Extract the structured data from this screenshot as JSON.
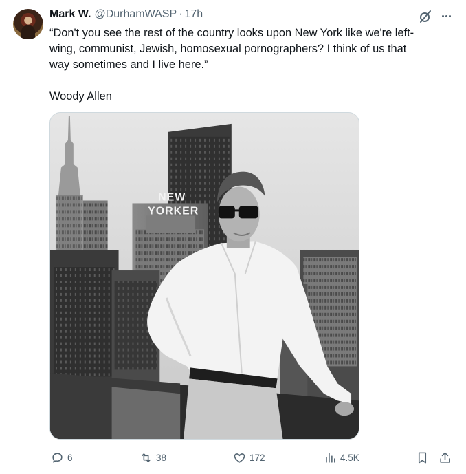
{
  "tweet": {
    "author_name": "Mark W.",
    "handle": "@DurhamWASP",
    "separator": "·",
    "time": "17h",
    "text_lines": [
      "“Don't you see the rest of the country looks upon New York like we're left-",
      "wing, communist, Jewish, homosexual pornographers? I think of us that",
      "way sometimes and I live here.”"
    ],
    "attribution": "Woody Allen",
    "media": {
      "sign_line1": "NEW",
      "sign_line2": "YORKER"
    }
  },
  "actions": {
    "reply_count": "6",
    "retweet_count": "38",
    "like_count": "172",
    "views_count": "4.5K"
  },
  "icons": {
    "more": "more-dots-icon",
    "grok": "grok-icon",
    "reply": "reply-icon",
    "retweet": "retweet-icon",
    "like": "heart-icon",
    "views": "views-icon",
    "bookmark": "bookmark-icon",
    "share": "share-icon"
  },
  "colors": {
    "text_primary": "#0f1419",
    "text_secondary": "#536471",
    "border": "#cfd9de"
  }
}
